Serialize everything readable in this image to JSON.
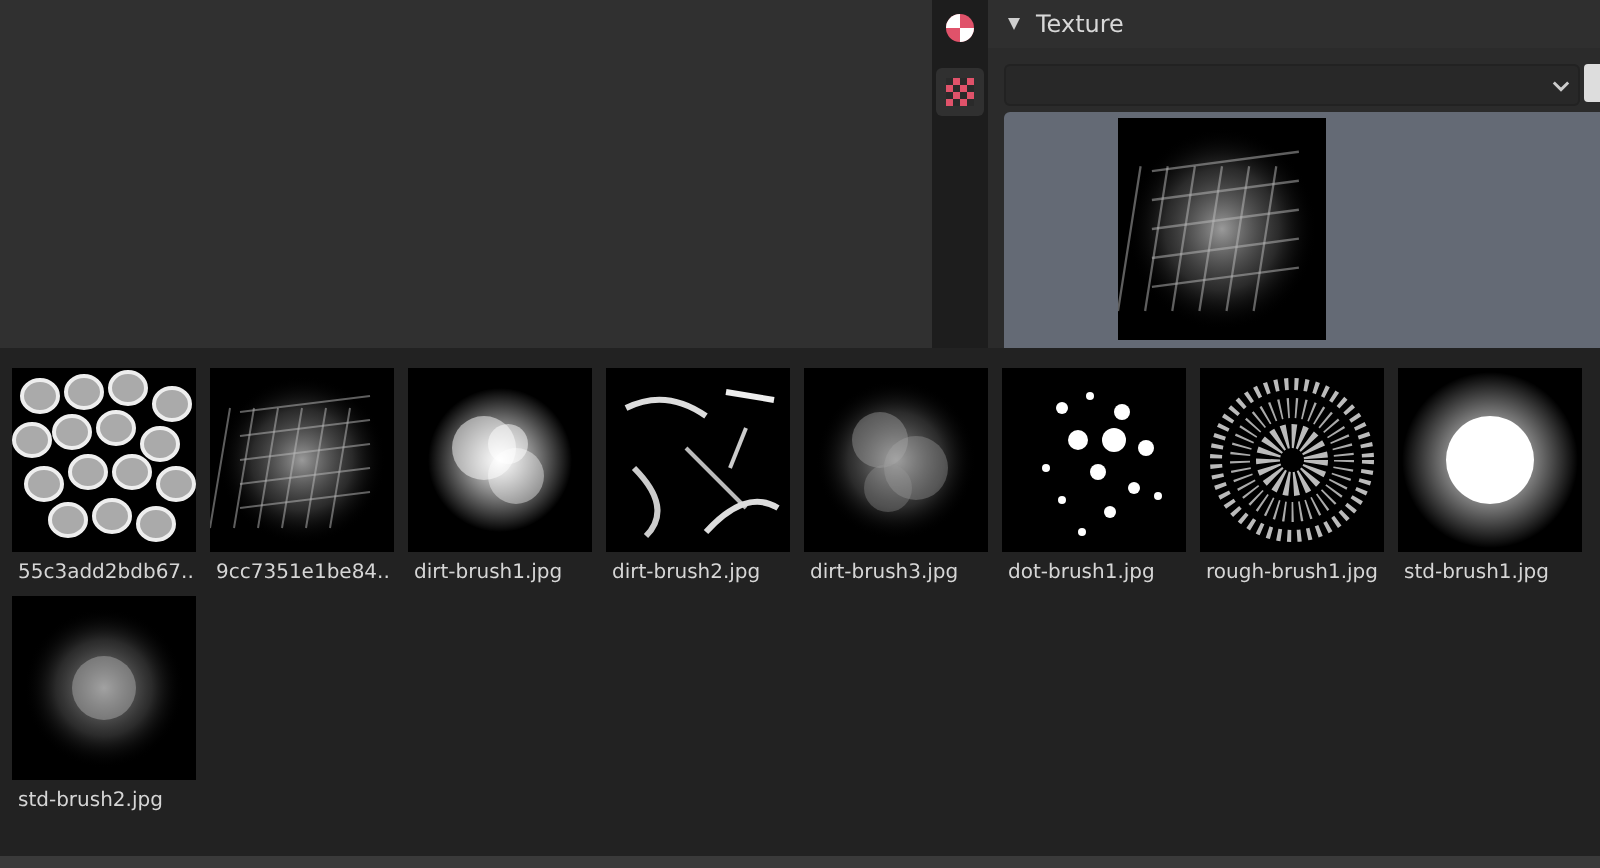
{
  "properties_panel": {
    "title": "Texture",
    "expanded": true
  },
  "texture_browser": {
    "items": [
      {
        "label": "55c3add2bdb67..",
        "kind": "picture"
      },
      {
        "label": "9cc7351e1be84..",
        "kind": "picture"
      },
      {
        "label": "dirt-brush1.jpg",
        "kind": "picture"
      },
      {
        "label": "dirt-brush2.jpg",
        "kind": "picture"
      },
      {
        "label": "dirt-brush3.jpg",
        "kind": "picture"
      },
      {
        "label": "dot-brush1.jpg",
        "kind": "picture"
      },
      {
        "label": "rough-brush1.jpg",
        "kind": "picture"
      },
      {
        "label": "std-brush1.jpg",
        "kind": "picture"
      },
      {
        "label": "std-brush2.jpg",
        "kind": "picture"
      }
    ]
  }
}
